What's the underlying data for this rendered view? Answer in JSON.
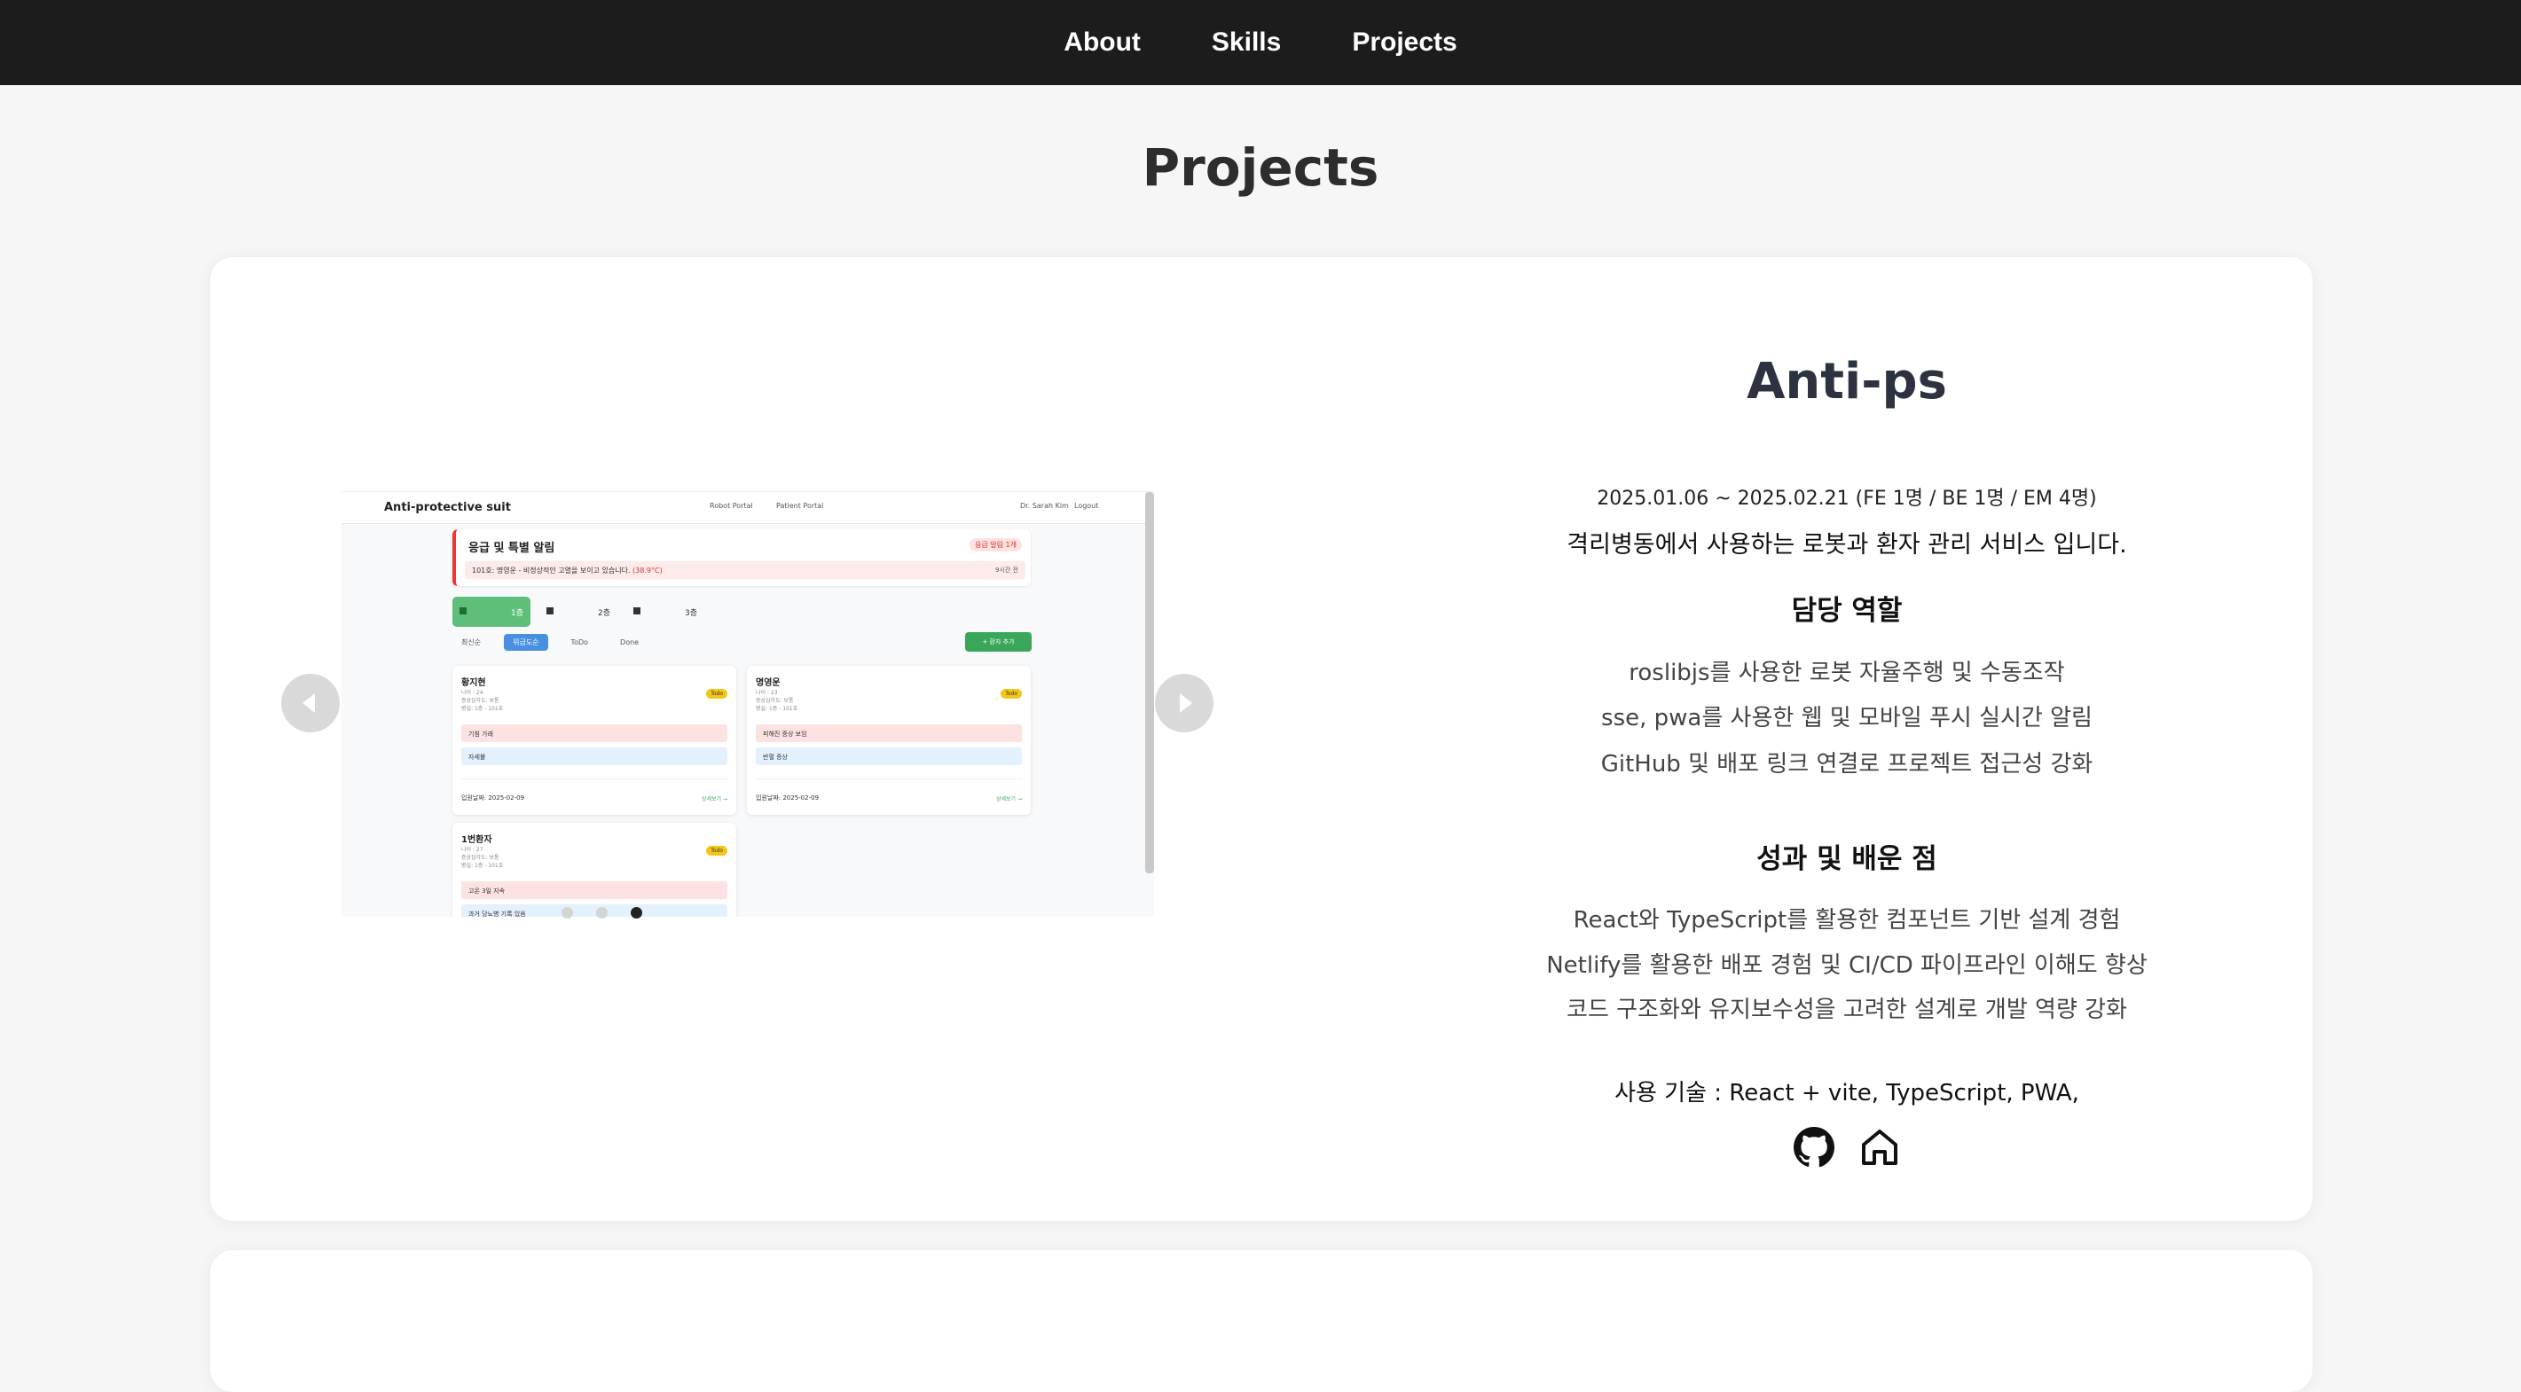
{
  "nav": {
    "items": [
      "About",
      "Skills",
      "Projects"
    ]
  },
  "section": {
    "title": "Projects"
  },
  "project": {
    "title": "Anti-ps",
    "period": "2025.01.06 ~ 2025.02.21 (FE 1명 / BE 1명 / EM 4명)",
    "description": "격리병동에서 사용하는 로봇과 환자 관리 서비스 입니다.",
    "role_heading": "담당 역할",
    "roles": [
      "roslibjs를 사용한 로봇 자율주행 및 수동조작",
      "sse, pwa를 사용한 웹 및 모바일 푸시 실시간 알림",
      "GitHub 및 배포 링크 연결로 프로젝트 접근성 강화"
    ],
    "learn_heading": "성과 및 배운 점",
    "learnings": [
      "React와 TypeScript를 활용한 컴포넌트 기반 설계 경험",
      "Netlify를 활용한 배포 경험 및 CI/CD 파이프라인 이해도 향상",
      "코드 구조화와 유지보수성을 고려한 설계로 개발 역량 강화"
    ],
    "tech": "사용 기술 : React + vite, TypeScript, PWA,",
    "links": [
      "github-icon",
      "home-icon"
    ]
  },
  "carousel": {
    "slides": 3,
    "active": 3,
    "screenshot": {
      "brand": "Anti-protective suit",
      "nav_robot": "Robot Portal",
      "nav_patient": "Patient Portal",
      "user": "Dr. Sarah Kim",
      "logout": "Logout",
      "alert_title": "응급 및 특별 알림",
      "alert_pill": "응급 알림 1개",
      "alert_text": "101호: 명영운 - 비정상적인 고열을 보이고 있습니다.",
      "alert_temp": "(38.9°C)",
      "alert_ago": "9시간 전",
      "stats": [
        "1층",
        "2층",
        "3층"
      ],
      "tabs": [
        "최신순",
        "위급도순",
        "ToDo",
        "Done"
      ],
      "add_button": "+ 환자 추가",
      "patients": [
        {
          "name": "황지현",
          "meta": [
            "나이 : 24",
            "증상심각도: 보통",
            "병실: 1층 - 101호"
          ],
          "badge": "Todo",
          "risk": "기침 가래",
          "info": "자세불",
          "date": "입원날짜: 2025-02-09",
          "more": "상세보기 →"
        },
        {
          "name": "명영운",
          "meta": [
            "나이 : 23",
            "증상심각도: 보통",
            "병실: 1층 - 101호"
          ],
          "badge": "Todo",
          "risk": "피해진 증상 보임",
          "info": "반혈 증상",
          "date": "입원날짜: 2025-02-09",
          "more": "상세보기 →"
        },
        {
          "name": "1번환자",
          "meta": [
            "나이 : 27",
            "증상심각도: 보통",
            "병실: 1층 - 101호"
          ],
          "badge": "Todo",
          "risk": "고온 3일 지속",
          "info": "과거 당뇨병 기록 있음",
          "date": "",
          "more": ""
        }
      ]
    }
  }
}
